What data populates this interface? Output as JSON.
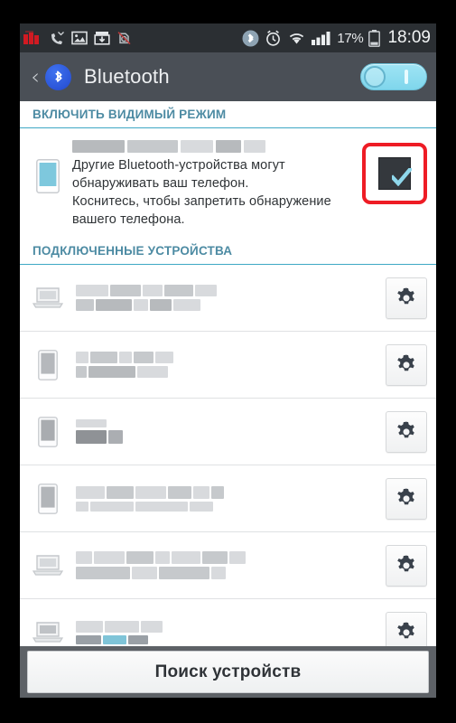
{
  "statusbar": {
    "icons_left": [
      "carrier-signal-icon",
      "missed-call-icon",
      "gallery-image-icon",
      "download-box-icon",
      "no-sim-icon"
    ],
    "icons_right": [
      "bluetooth-icon",
      "alarm-clock-icon",
      "wifi-icon",
      "cellular-signal-icon"
    ],
    "battery_percent": "17%",
    "battery_icon": "battery-icon",
    "clock": "18:09"
  },
  "titlebar": {
    "back_icon": "back-chevron-icon",
    "app_icon": "bluetooth-logo-icon",
    "title": "Bluetooth",
    "toggle_state": "on",
    "toggle_label": "Bluetooth on"
  },
  "sections": {
    "visibility_header": "ВКЛЮЧИТЬ ВИДИМЫЙ РЕЖИМ",
    "paired_header": "ПОДКЛЮЧЕННЫЕ УСТРОЙСТВА"
  },
  "visibility": {
    "device_name": "",
    "description": "Другие Bluetooth-устройства могут обнаруживать ваш телефон. Коснитесь, чтобы запретить обнаружение вашего телефона.",
    "line1": "Другие Bluetooth-устройства могут",
    "line2": "обнаруживать ваш телефон.",
    "line3": "Коснитесь, чтобы запретить обнаружение",
    "line4": "вашего телефона.",
    "icon": "phone-icon",
    "checkbox_checked": true,
    "checkbox_highlight_color": "#ee1c25"
  },
  "devices": [
    {
      "icon": "laptop-icon",
      "name": "",
      "action_icon": "gear-icon"
    },
    {
      "icon": "phone-icon",
      "name": "",
      "action_icon": "gear-icon"
    },
    {
      "icon": "phone-icon",
      "name": "",
      "action_icon": "gear-icon"
    },
    {
      "icon": "phone-icon",
      "name": "",
      "action_icon": "gear-icon"
    },
    {
      "icon": "laptop-icon",
      "name": "",
      "action_icon": "gear-icon"
    },
    {
      "icon": "laptop-icon",
      "name": "",
      "action_icon": "gear-icon"
    }
  ],
  "bottombar": {
    "search_label": "Поиск устройств"
  },
  "colors": {
    "accent": "#3ea8c4",
    "section_text": "#4d8ba3",
    "highlight": "#ee1c25",
    "titlebar_bg": "#4a4f56",
    "statusbar_bg": "#2b2f33",
    "toggle_on": "#8fdcef"
  }
}
